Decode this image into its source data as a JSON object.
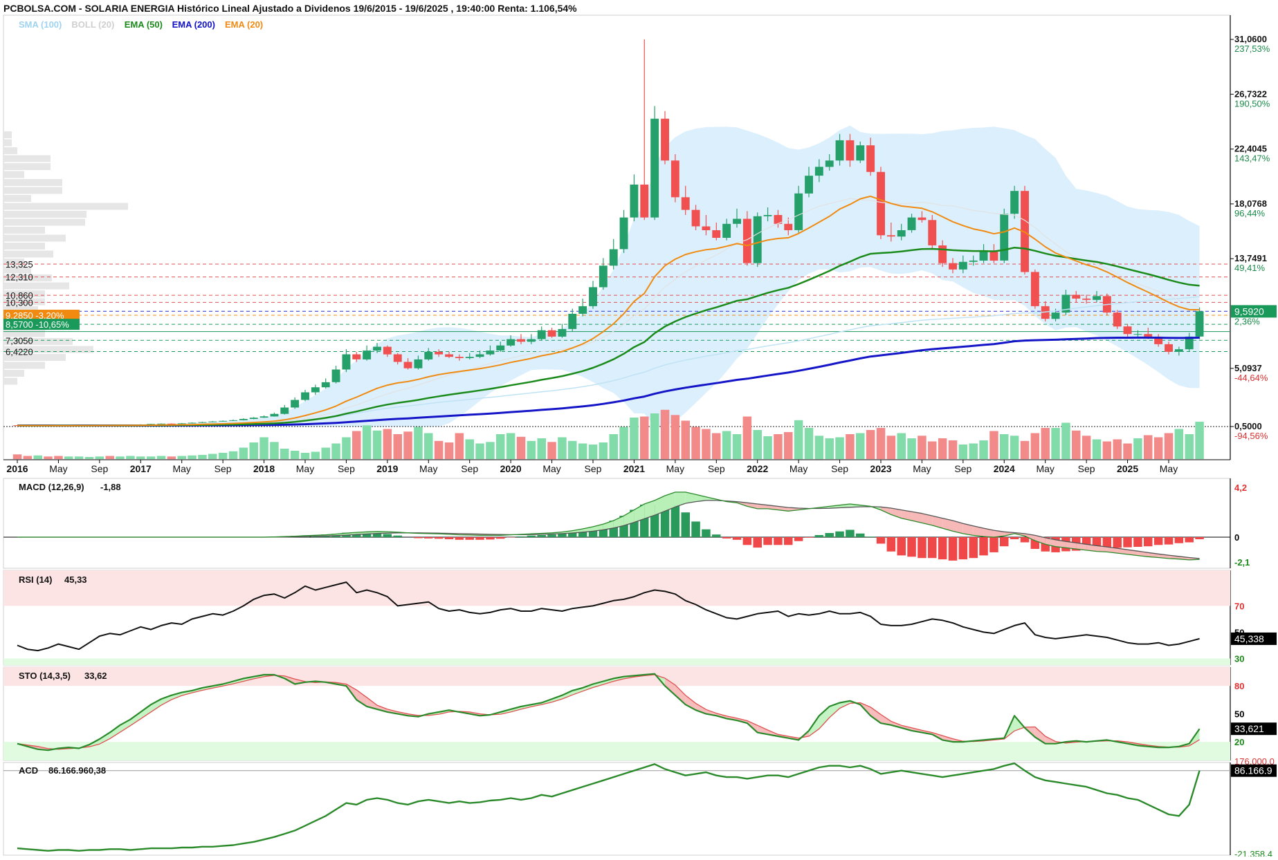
{
  "header": {
    "title": "PCBOLSA.COM - SOLARIA ENERGIA Histórico Lineal Ajustado a Dividenos 19/6/2015 - 19/6/2025 , 19:40:00 Renta: 1.106,54%"
  },
  "legend": [
    {
      "label": "SMA (100)",
      "color": "#9fd3f0"
    },
    {
      "label": "BOLL (20)",
      "color": "#cfcfcf"
    },
    {
      "label": "EMA (50)",
      "color": "#1a8a1a"
    },
    {
      "label": "EMA (200)",
      "color": "#1010c8"
    },
    {
      "label": "EMA (20)",
      "color": "#f08a10"
    }
  ],
  "price_axis": [
    {
      "value": 31.06,
      "label": "31,0600",
      "pct": "237,53%",
      "pct_color": "#1a8a4a"
    },
    {
      "value": 26.7322,
      "label": "26,7322",
      "pct": "190,50%",
      "pct_color": "#1a8a4a"
    },
    {
      "value": 22.4045,
      "label": "22,4045",
      "pct": "143,47%",
      "pct_color": "#1a8a4a"
    },
    {
      "value": 18.0768,
      "label": "18,0768",
      "pct": "96,44%",
      "pct_color": "#1a8a4a"
    },
    {
      "value": 13.7491,
      "label": "13,7491",
      "pct": "49,41%",
      "pct_color": "#1a8a4a"
    },
    {
      "value": 5.0937,
      "label": "5,0937",
      "pct": "-44,64%",
      "pct_color": "#e03030"
    },
    {
      "value": 0.5,
      "label": "0,5000",
      "pct": "-94,56%",
      "pct_color": "#e03030"
    }
  ],
  "current_price": {
    "value": 9.592,
    "label": "9,5920",
    "pct": "2,36%"
  },
  "left_levels": [
    {
      "value": 13.325,
      "label": "13,325"
    },
    {
      "value": 12.31,
      "label": "12,310"
    },
    {
      "value": 10.86,
      "label": "10,860"
    },
    {
      "value": 10.3,
      "label": "10,300"
    },
    {
      "value": 9.285,
      "label": "9,2850  -3,20%",
      "badge": "#f08a10"
    },
    {
      "value": 8.57,
      "label": "8,5700  -10,65%",
      "badge": "#1a9a5a"
    },
    {
      "value": 7.305,
      "label": "7,3050"
    },
    {
      "value": 6.422,
      "label": "6,4220"
    }
  ],
  "x_axis": [
    {
      "label": "2016",
      "bold": true
    },
    {
      "label": "May",
      "bold": false
    },
    {
      "label": "Sep",
      "bold": false
    },
    {
      "label": "2017",
      "bold": true
    },
    {
      "label": "May",
      "bold": false
    },
    {
      "label": "Sep",
      "bold": false
    },
    {
      "label": "2018",
      "bold": true
    },
    {
      "label": "May",
      "bold": false
    },
    {
      "label": "Sep",
      "bold": false
    },
    {
      "label": "2019",
      "bold": true
    },
    {
      "label": "May",
      "bold": false
    },
    {
      "label": "Sep",
      "bold": false
    },
    {
      "label": "2020",
      "bold": true
    },
    {
      "label": "May",
      "bold": false
    },
    {
      "label": "Sep",
      "bold": false
    },
    {
      "label": "2021",
      "bold": true
    },
    {
      "label": "May",
      "bold": false
    },
    {
      "label": "Sep",
      "bold": false
    },
    {
      "label": "2022",
      "bold": true
    },
    {
      "label": "May",
      "bold": false
    },
    {
      "label": "Sep",
      "bold": false
    },
    {
      "label": "2023",
      "bold": true
    },
    {
      "label": "May",
      "bold": false
    },
    {
      "label": "Sep",
      "bold": false
    },
    {
      "label": "2024",
      "bold": true
    },
    {
      "label": "May",
      "bold": false
    },
    {
      "label": "Sep",
      "bold": false
    },
    {
      "label": "2025",
      "bold": true
    },
    {
      "label": "May",
      "bold": false
    }
  ],
  "macd": {
    "label": "MACD (12,26,9)",
    "value": "-1,88",
    "axis": [
      {
        "value": 4.2,
        "label": "4,2",
        "color": "#e03030"
      },
      {
        "value": 0,
        "label": "0",
        "color": "#000000"
      },
      {
        "value": -2.1,
        "label": "-2,1",
        "color": "#1a8a1a"
      }
    ]
  },
  "rsi": {
    "label": "RSI (14)",
    "value": "45,33",
    "readout": "45,338",
    "axis": [
      {
        "value": 70,
        "label": "70",
        "color": "#e03030"
      },
      {
        "value": 50,
        "label": "50",
        "color": "#000000"
      },
      {
        "value": 30,
        "label": "30",
        "color": "#1a8a1a"
      }
    ]
  },
  "sto": {
    "label": "STO (14,3,5)",
    "value": "33,62",
    "readout": "33,621",
    "axis": [
      {
        "value": 80,
        "label": "80",
        "color": "#e03030"
      },
      {
        "value": 50,
        "label": "50",
        "color": "#000000"
      },
      {
        "value": 20,
        "label": "20",
        "color": "#1a8a1a"
      }
    ]
  },
  "acd": {
    "label": "ACD",
    "value": "86.166.960,38",
    "readout": "86.166.9",
    "axis_top": "176.000.0",
    "axis_bottom": "-21.358.4"
  },
  "chart_data": {
    "type": "candlestick",
    "title": "SOLARIA ENERGIA Histórico Lineal Ajustado a Dividenos 19/6/2015 - 19/6/2025",
    "interval": "monthly",
    "first_month": "2016-01",
    "ylim": [
      0.5,
      31.06
    ],
    "open": [
      0.6,
      0.58,
      0.55,
      0.57,
      0.56,
      0.55,
      0.57,
      0.59,
      0.6,
      0.62,
      0.6,
      0.61,
      0.63,
      0.66,
      0.7,
      0.73,
      0.72,
      0.75,
      0.8,
      0.85,
      0.9,
      0.95,
      1.0,
      1.1,
      1.2,
      1.3,
      1.5,
      2.0,
      2.6,
      3.2,
      3.6,
      4.0,
      5.0,
      6.2,
      5.8,
      6.5,
      6.8,
      6.2,
      5.6,
      5.1,
      5.8,
      6.4,
      6.2,
      6.0,
      5.9,
      6.0,
      6.2,
      6.5,
      6.9,
      7.4,
      7.2,
      7.4,
      8.1,
      7.6,
      8.2,
      9.4,
      10.0,
      11.5,
      13.2,
      14.5,
      17.0,
      19.6,
      17.0,
      24.8,
      21.5,
      18.6,
      17.6,
      16.3,
      16.0,
      15.4,
      16.5,
      16.9,
      13.4,
      17.1,
      17.2,
      16.5,
      16.0,
      18.9,
      20.3,
      21.0,
      21.5,
      23.1,
      21.5,
      22.7,
      20.6,
      15.6,
      15.5,
      16.0,
      17.0,
      16.8,
      14.8,
      13.4,
      12.9,
      13.5,
      13.6,
      14.4,
      13.6,
      17.3,
      19.1,
      12.7,
      10.0,
      9.0,
      9.5,
      10.9,
      10.6,
      10.5,
      10.8,
      9.5,
      8.4,
      7.8,
      7.8,
      7.6,
      7.0,
      6.4,
      6.6,
      7.6
    ],
    "close": [
      0.58,
      0.55,
      0.57,
      0.56,
      0.55,
      0.57,
      0.59,
      0.6,
      0.62,
      0.6,
      0.61,
      0.63,
      0.66,
      0.7,
      0.73,
      0.72,
      0.75,
      0.8,
      0.85,
      0.9,
      0.95,
      1.0,
      1.1,
      1.2,
      1.3,
      1.5,
      2.0,
      2.6,
      3.2,
      3.6,
      4.0,
      5.0,
      6.2,
      5.8,
      6.5,
      6.8,
      6.2,
      5.6,
      5.1,
      5.8,
      6.4,
      6.2,
      6.0,
      5.9,
      6.0,
      6.2,
      6.5,
      6.9,
      7.4,
      7.2,
      7.4,
      8.1,
      7.6,
      8.2,
      9.4,
      10.0,
      11.5,
      13.2,
      14.5,
      17.0,
      19.6,
      17.0,
      24.8,
      21.5,
      18.6,
      17.6,
      16.3,
      16.0,
      15.4,
      16.5,
      16.9,
      13.4,
      17.1,
      17.2,
      16.5,
      16.0,
      18.9,
      20.3,
      21.0,
      21.5,
      23.1,
      21.5,
      22.7,
      20.6,
      15.6,
      15.5,
      16.0,
      17.0,
      16.8,
      14.8,
      13.4,
      12.9,
      13.5,
      13.6,
      14.4,
      13.6,
      17.3,
      19.1,
      12.7,
      10.0,
      9.0,
      9.5,
      10.9,
      10.6,
      10.5,
      10.8,
      9.5,
      8.4,
      7.8,
      7.8,
      7.6,
      7.0,
      6.4,
      6.6,
      7.6,
      9.6
    ],
    "high": [
      0.62,
      0.6,
      0.59,
      0.58,
      0.58,
      0.58,
      0.61,
      0.62,
      0.64,
      0.63,
      0.63,
      0.65,
      0.68,
      0.72,
      0.75,
      0.75,
      0.78,
      0.83,
      0.88,
      0.93,
      0.98,
      1.05,
      1.15,
      1.25,
      1.38,
      1.6,
      2.2,
      2.8,
      3.4,
      3.8,
      4.3,
      5.3,
      6.6,
      6.4,
      6.9,
      7.1,
      6.9,
      6.3,
      5.9,
      6.1,
      6.7,
      6.6,
      6.4,
      6.2,
      6.3,
      6.5,
      6.9,
      7.2,
      7.7,
      7.8,
      7.8,
      8.4,
      8.3,
      8.6,
      9.8,
      10.6,
      12.0,
      13.8,
      15.3,
      17.6,
      20.4,
      31.06,
      25.8,
      25.4,
      22.0,
      19.5,
      18.0,
      17.2,
      16.6,
      16.9,
      17.7,
      17.5,
      17.4,
      17.8,
      17.6,
      17.0,
      19.5,
      21.0,
      21.6,
      22.0,
      23.6,
      23.6,
      23.0,
      23.3,
      21.0,
      16.6,
      16.5,
      17.3,
      17.5,
      17.2,
      15.2,
      13.8,
      14.0,
      14.0,
      14.9,
      14.9,
      17.7,
      19.5,
      19.5,
      12.9,
      10.4,
      9.8,
      11.3,
      11.2,
      10.9,
      11.2,
      11.0,
      9.7,
      8.6,
      8.1,
      8.3,
      7.8,
      7.2,
      6.8,
      7.9,
      9.9
    ],
    "low": [
      0.56,
      0.53,
      0.53,
      0.55,
      0.54,
      0.54,
      0.56,
      0.58,
      0.59,
      0.59,
      0.59,
      0.6,
      0.62,
      0.65,
      0.69,
      0.7,
      0.71,
      0.74,
      0.79,
      0.84,
      0.89,
      0.94,
      0.98,
      1.08,
      1.18,
      1.28,
      1.45,
      1.9,
      2.5,
      3.0,
      3.5,
      3.9,
      4.8,
      5.6,
      5.7,
      6.3,
      6.0,
      5.4,
      5.0,
      5.0,
      5.7,
      6.0,
      5.9,
      5.7,
      5.8,
      5.9,
      6.1,
      6.4,
      6.8,
      7.0,
      7.0,
      7.3,
      7.5,
      7.5,
      8.0,
      9.2,
      9.8,
      11.3,
      12.9,
      14.2,
      16.7,
      16.8,
      16.8,
      21.2,
      18.2,
      17.2,
      16.0,
      15.6,
      15.2,
      15.2,
      16.2,
      13.2,
      13.1,
      16.7,
      16.2,
      15.6,
      15.8,
      18.6,
      19.8,
      20.7,
      21.1,
      21.0,
      21.3,
      20.3,
      15.3,
      15.1,
      15.2,
      15.8,
      16.6,
      14.5,
      13.1,
      12.6,
      12.6,
      13.2,
      13.4,
      13.4,
      13.4,
      16.9,
      12.5,
      9.8,
      8.8,
      8.8,
      9.3,
      10.3,
      10.2,
      10.3,
      9.3,
      8.2,
      7.6,
      7.6,
      7.4,
      6.8,
      6.2,
      6.1,
      6.4,
      7.4
    ],
    "volume": [
      0.09,
      0.06,
      0.07,
      0.05,
      0.06,
      0.05,
      0.05,
      0.04,
      0.05,
      0.06,
      0.05,
      0.06,
      0.05,
      0.05,
      0.06,
      0.05,
      0.06,
      0.07,
      0.08,
      0.1,
      0.12,
      0.15,
      0.22,
      0.32,
      0.42,
      0.33,
      0.2,
      0.16,
      0.12,
      0.14,
      0.22,
      0.3,
      0.42,
      0.54,
      0.65,
      0.55,
      0.58,
      0.48,
      0.53,
      0.62,
      0.5,
      0.35,
      0.32,
      0.5,
      0.38,
      0.3,
      0.33,
      0.48,
      0.5,
      0.43,
      0.35,
      0.4,
      0.33,
      0.42,
      0.35,
      0.3,
      0.28,
      0.32,
      0.48,
      0.62,
      0.8,
      0.82,
      0.88,
      0.95,
      0.85,
      0.74,
      0.62,
      0.58,
      0.5,
      0.54,
      0.48,
      0.82,
      0.56,
      0.44,
      0.48,
      0.52,
      0.75,
      0.6,
      0.45,
      0.4,
      0.42,
      0.48,
      0.5,
      0.56,
      0.6,
      0.45,
      0.5,
      0.4,
      0.45,
      0.34,
      0.4,
      0.36,
      0.28,
      0.3,
      0.36,
      0.54,
      0.48,
      0.45,
      0.35,
      0.5,
      0.6,
      0.6,
      0.7,
      0.55,
      0.45,
      0.38,
      0.34,
      0.38,
      0.3,
      0.4,
      0.46,
      0.42,
      0.5,
      0.58,
      0.48,
      0.72,
      0.65
    ],
    "rsi": [
      40,
      37,
      36,
      38,
      41,
      39,
      37,
      42,
      47,
      49,
      48,
      51,
      54,
      52,
      55,
      57,
      56,
      60,
      62,
      64,
      63,
      66,
      70,
      75,
      78,
      79,
      76,
      80,
      85,
      82,
      84,
      86,
      88,
      80,
      82,
      80,
      77,
      70,
      71,
      72,
      73,
      68,
      66,
      67,
      65,
      64,
      65,
      67,
      68,
      66,
      66,
      68,
      67,
      66,
      68,
      69,
      70,
      72,
      74,
      75,
      77,
      80,
      82,
      81,
      79,
      74,
      71,
      67,
      64,
      61,
      60,
      62,
      64,
      65,
      66,
      62,
      64,
      63,
      64,
      66,
      64,
      64,
      65,
      62,
      56,
      55,
      55,
      56,
      58,
      60,
      59,
      57,
      54,
      52,
      50,
      49,
      52,
      55,
      57,
      48,
      46,
      45,
      46,
      47,
      48,
      47,
      46,
      44,
      42,
      41,
      41,
      42,
      40,
      41,
      43,
      45
    ],
    "sto": [
      18,
      15,
      12,
      11,
      13,
      14,
      13,
      17,
      23,
      30,
      38,
      44,
      52,
      60,
      66,
      70,
      73,
      75,
      78,
      80,
      82,
      85,
      88,
      90,
      92,
      92,
      88,
      82,
      84,
      85,
      84,
      82,
      80,
      65,
      58,
      55,
      52,
      50,
      48,
      47,
      50,
      52,
      54,
      52,
      50,
      48,
      49,
      52,
      55,
      58,
      60,
      62,
      66,
      70,
      75,
      78,
      82,
      85,
      88,
      90,
      91,
      92,
      93,
      80,
      70,
      60,
      54,
      50,
      48,
      45,
      43,
      40,
      30,
      28,
      26,
      24,
      22,
      32,
      48,
      58,
      62,
      64,
      60,
      48,
      40,
      38,
      35,
      32,
      30,
      28,
      22,
      20,
      20,
      21,
      22,
      23,
      24,
      48,
      35,
      25,
      18,
      18,
      20,
      21,
      20,
      21,
      22,
      20,
      18,
      16,
      15,
      14,
      14,
      15,
      18,
      34
    ],
    "macd": [
      0.0,
      0.0,
      0.0,
      0.0,
      0.0,
      0.0,
      0.0,
      0.0,
      0.0,
      0.0,
      0.0,
      0.0,
      0.0,
      0.0,
      0.0,
      0.0,
      0.0,
      0.0,
      0.0,
      0.0,
      0.0,
      0.0,
      0.0,
      0.0,
      0.0,
      0.02,
      0.05,
      0.08,
      0.12,
      0.16,
      0.2,
      0.26,
      0.34,
      0.4,
      0.45,
      0.48,
      0.46,
      0.42,
      0.36,
      0.32,
      0.3,
      0.28,
      0.24,
      0.2,
      0.18,
      0.16,
      0.15,
      0.16,
      0.2,
      0.24,
      0.28,
      0.32,
      0.36,
      0.44,
      0.55,
      0.7,
      0.88,
      1.1,
      1.4,
      1.8,
      2.3,
      2.8,
      3.1,
      3.5,
      3.8,
      3.8,
      3.6,
      3.4,
      3.2,
      3.0,
      2.9,
      2.6,
      2.4,
      2.4,
      2.3,
      2.2,
      2.3,
      2.4,
      2.5,
      2.6,
      2.7,
      2.8,
      2.7,
      2.6,
      2.3,
      1.9,
      1.6,
      1.4,
      1.2,
      1.0,
      0.75,
      0.5,
      0.3,
      0.15,
      0.05,
      0.0,
      0.1,
      0.3,
      0.1,
      -0.3,
      -0.6,
      -0.8,
      -0.9,
      -1.0,
      -1.1,
      -1.2,
      -1.25,
      -1.35,
      -1.45,
      -1.55,
      -1.65,
      -1.72,
      -1.8,
      -1.85,
      -1.92,
      -1.88
    ],
    "signal": [
      0.0,
      0.0,
      0.0,
      0.0,
      0.0,
      0.0,
      0.0,
      0.0,
      0.0,
      0.0,
      0.0,
      0.0,
      0.0,
      0.0,
      0.0,
      0.0,
      0.0,
      0.0,
      0.0,
      0.0,
      0.0,
      0.0,
      0.0,
      0.0,
      0.0,
      0.01,
      0.02,
      0.03,
      0.05,
      0.08,
      0.1,
      0.13,
      0.17,
      0.22,
      0.27,
      0.31,
      0.34,
      0.36,
      0.36,
      0.36,
      0.35,
      0.34,
      0.32,
      0.3,
      0.28,
      0.26,
      0.24,
      0.22,
      0.21,
      0.21,
      0.22,
      0.24,
      0.26,
      0.3,
      0.35,
      0.42,
      0.5,
      0.62,
      0.77,
      0.98,
      1.25,
      1.55,
      1.85,
      2.2,
      2.55,
      2.85,
      3.0,
      3.1,
      3.1,
      3.05,
      3.0,
      2.9,
      2.8,
      2.7,
      2.6,
      2.5,
      2.45,
      2.42,
      2.42,
      2.44,
      2.48,
      2.52,
      2.56,
      2.58,
      2.55,
      2.45,
      2.3,
      2.15,
      2.0,
      1.8,
      1.6,
      1.4,
      1.15,
      0.95,
      0.75,
      0.58,
      0.45,
      0.38,
      0.3,
      0.15,
      -0.05,
      -0.22,
      -0.36,
      -0.48,
      -0.6,
      -0.72,
      -0.82,
      -0.94,
      -1.06,
      -1.18,
      -1.3,
      -1.42,
      -1.52,
      -1.62,
      -1.72,
      -1.8
    ],
    "acd": [
      -10,
      -11,
      -12,
      -13,
      -12,
      -12,
      -13,
      -12,
      -12,
      -11,
      -11,
      -12,
      -11,
      -10,
      -10,
      -10,
      -9,
      -9,
      -8,
      -8,
      -7,
      -6,
      -4,
      -2,
      1,
      4,
      8,
      12,
      18,
      24,
      30,
      38,
      46,
      44,
      50,
      52,
      50,
      46,
      44,
      48,
      50,
      48,
      46,
      48,
      46,
      47,
      49,
      50,
      52,
      50,
      52,
      56,
      54,
      58,
      62,
      66,
      70,
      74,
      78,
      82,
      86,
      90,
      94,
      88,
      84,
      80,
      82,
      84,
      80,
      78,
      78,
      76,
      78,
      80,
      80,
      78,
      82,
      86,
      90,
      92,
      92,
      90,
      92,
      88,
      82,
      84,
      86,
      84,
      82,
      80,
      78,
      80,
      82,
      84,
      86,
      88,
      92,
      95,
      86,
      78,
      74,
      72,
      70,
      68,
      66,
      62,
      58,
      56,
      52,
      50,
      44,
      38,
      32,
      30,
      44,
      86
    ]
  }
}
